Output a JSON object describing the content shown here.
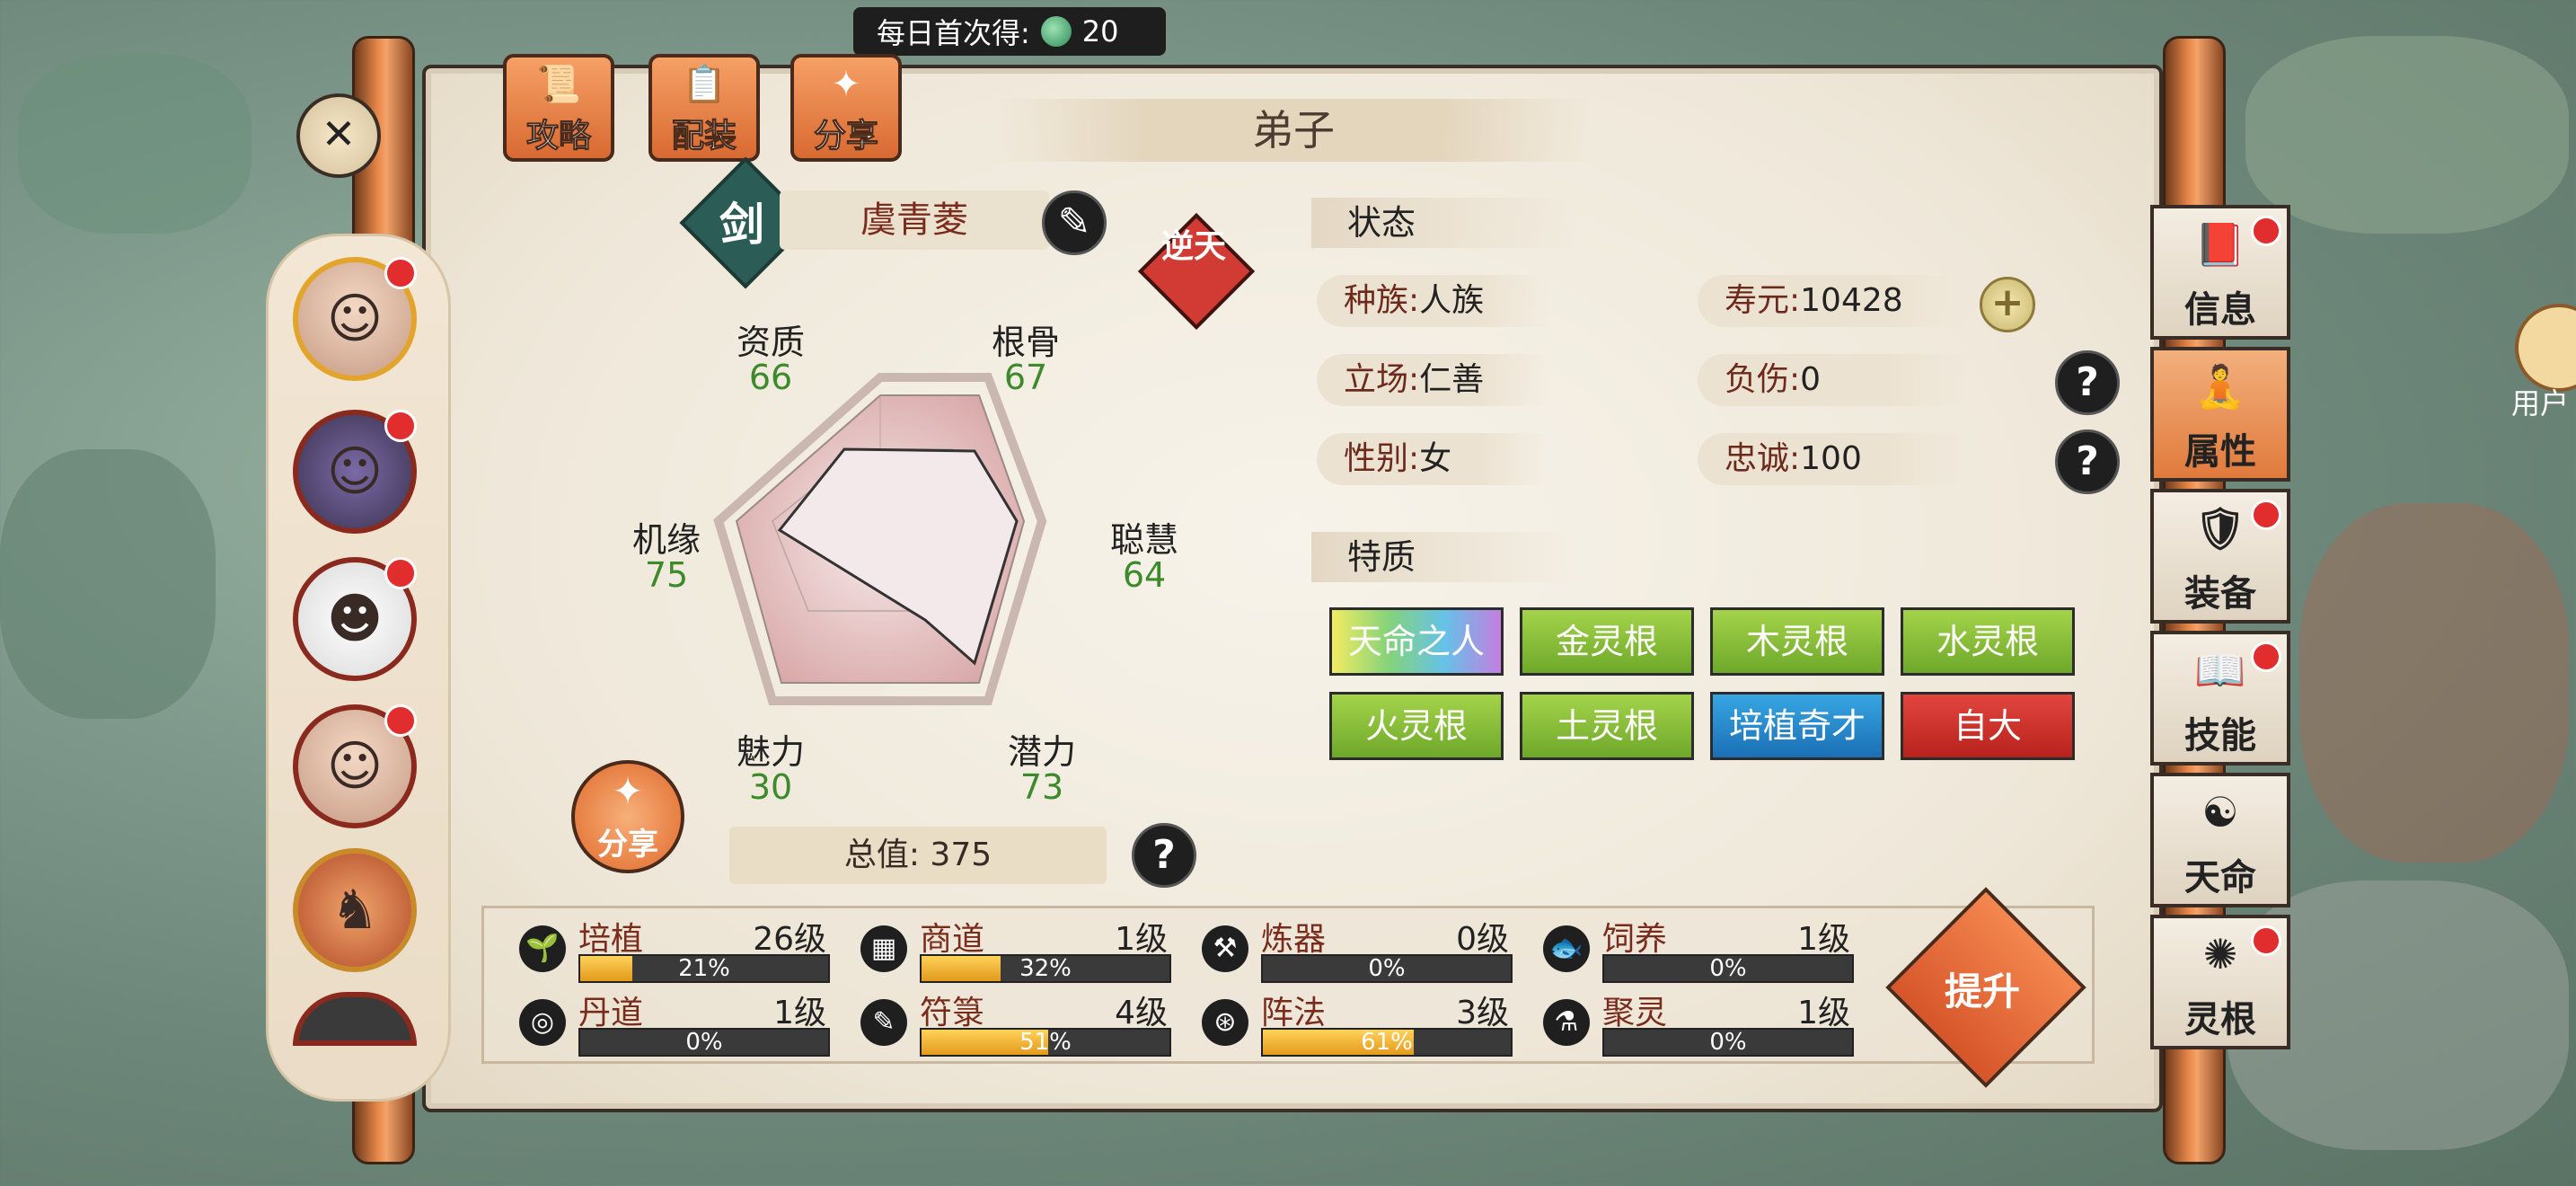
{
  "daily_badge": {
    "label": "每日首次得:",
    "value": "20"
  },
  "top_tabs": [
    "攻略",
    "配装",
    "分享"
  ],
  "title": "弟子",
  "disciple": {
    "sword_glyph": "剑",
    "name": "虞青菱",
    "nitian": "逆天"
  },
  "attributes": [
    {
      "label": "资质",
      "value": "66"
    },
    {
      "label": "根骨",
      "value": "67"
    },
    {
      "label": "聪慧",
      "value": "64"
    },
    {
      "label": "潜力",
      "value": "73"
    },
    {
      "label": "魅力",
      "value": "30"
    },
    {
      "label": "机缘",
      "value": "75"
    }
  ],
  "share_label": "分享",
  "total": "总值: 375",
  "status": {
    "heading": "状态",
    "race_k": "种族:",
    "race_v": "人族",
    "life_k": "寿元:",
    "life_v": "10428",
    "stance_k": "立场:",
    "stance_v": "仁善",
    "injury_k": "负伤:",
    "injury_v": "0",
    "gender_k": "性别:",
    "gender_v": "女",
    "loyal_k": "忠诚:",
    "loyal_v": "100"
  },
  "traits": {
    "heading": "特质",
    "items": [
      "天命之人",
      "金灵根",
      "木灵根",
      "水灵根",
      "火灵根",
      "土灵根",
      "培植奇才",
      "自大"
    ]
  },
  "skills": [
    {
      "name": "培植",
      "level": "26级",
      "pct": "21%",
      "progress": 0.21
    },
    {
      "name": "商道",
      "level": "1级",
      "pct": "32%",
      "progress": 0.32
    },
    {
      "name": "炼器",
      "level": "0级",
      "pct": "0%",
      "progress": 0
    },
    {
      "name": "饲养",
      "level": "1级",
      "pct": "0%",
      "progress": 0
    },
    {
      "name": "丹道",
      "level": "1级",
      "pct": "0%",
      "progress": 0
    },
    {
      "name": "符箓",
      "level": "4级",
      "pct": "51%",
      "progress": 0.51
    },
    {
      "name": "阵法",
      "level": "3级",
      "pct": "61%",
      "progress": 0.61
    },
    {
      "name": "聚灵",
      "level": "1级",
      "pct": "0%",
      "progress": 0
    }
  ],
  "upgrade_label": "提升",
  "right_tabs": [
    "信息",
    "属性",
    "装备",
    "技能",
    "天命",
    "灵根"
  ],
  "user_label": "用户"
}
